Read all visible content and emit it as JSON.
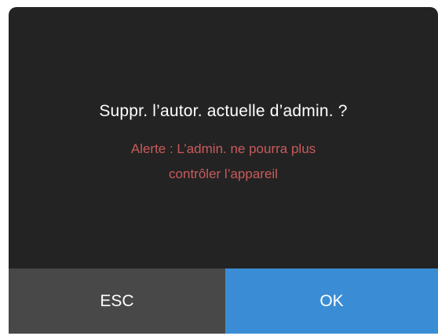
{
  "dialog": {
    "title": "Suppr. l’autor. actuelle d’admin. ?",
    "warning_line1": "Alerte : L’admin. ne pourra plus",
    "warning_line2": "contrôler l’appareil",
    "esc_label": "ESC",
    "ok_label": "OK"
  },
  "colors": {
    "background": "#232323",
    "title_text": "#ffffff",
    "warning_text": "#c95b5b",
    "esc_button": "#484848",
    "ok_button": "#3a8dd5"
  }
}
